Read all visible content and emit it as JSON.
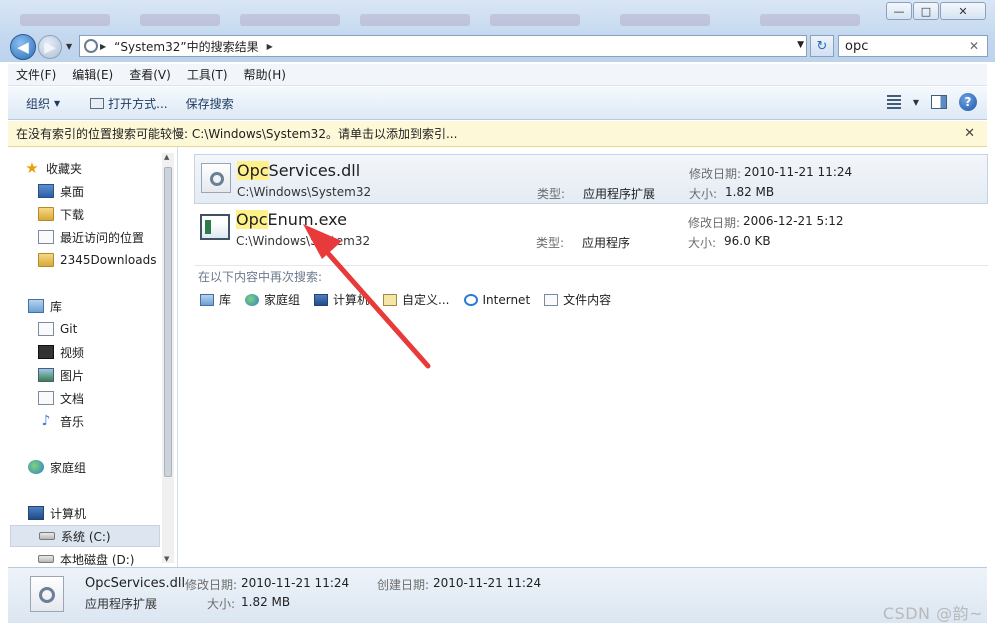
{
  "window": {
    "minimize_label": "—",
    "maximize_label": "□",
    "close_label": "✕"
  },
  "address": {
    "back_label": "◀",
    "forward_label": "▶",
    "breadcrumb": "“System32”中的搜索结果",
    "search_value": "opc",
    "refresh_label": "↻"
  },
  "menu": {
    "items": [
      "文件(F)",
      "编辑(E)",
      "查看(V)",
      "工具(T)",
      "帮助(H)"
    ]
  },
  "toolbar": {
    "organize": "组织",
    "open_with": "打开方式...",
    "save_search": "保存搜索"
  },
  "infobar": {
    "text": "在没有索引的位置搜索可能较慢: C:\\Windows\\System32。请单击以添加到索引..."
  },
  "sidebar": {
    "favorites": "收藏夹",
    "fav_items": [
      "桌面",
      "下载",
      "最近访问的位置",
      "2345Downloads"
    ],
    "libraries": "库",
    "lib_items": [
      "Git",
      "视频",
      "图片",
      "文档",
      "音乐"
    ],
    "homegroup": "家庭组",
    "computer": "计算机",
    "drives": [
      "系统 (C:)",
      "本地磁盘 (D:)"
    ]
  },
  "results": [
    {
      "name_hl": "Opc",
      "name_rest": "Services.dll",
      "path": "C:\\Windows\\System32",
      "type_label": "类型:",
      "type": "应用程序扩展",
      "mod_label": "修改日期:",
      "modified": "2010-11-21 11:24",
      "size_label": "大小:",
      "size": "1.82 MB"
    },
    {
      "name_hl": "Opc",
      "name_rest": "Enum.exe",
      "path": "C:\\Windows\\System32",
      "type_label": "类型:",
      "type": "应用程序",
      "mod_label": "修改日期:",
      "modified": "2006-12-21 5:12",
      "size_label": "大小:",
      "size": "96.0 KB"
    }
  ],
  "search_again": {
    "label": "在以下内容中再次搜索:",
    "items": [
      "库",
      "家庭组",
      "计算机",
      "自定义...",
      "Internet",
      "文件内容"
    ]
  },
  "details": {
    "name": "OpcServices.dll",
    "type": "应用程序扩展",
    "modified_label": "修改日期:",
    "modified": "2010-11-21 11:24",
    "created_label": "创建日期:",
    "created": "2010-11-21 11:24",
    "size_label": "大小:",
    "size": "1.82 MB"
  },
  "watermark": "CSDN @韵~",
  "colors": {
    "highlight": "#fef08a",
    "arrow": "#e83a3a",
    "infobar": "#fdf8d8"
  }
}
